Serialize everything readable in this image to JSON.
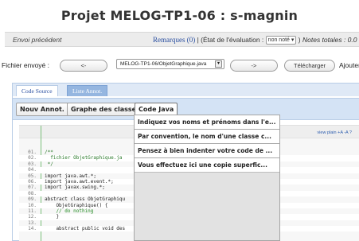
{
  "header": {
    "title": "Projet MELOG-TP1-06 : s-magnin"
  },
  "eval_bar": {
    "prev_label": "Envoi précédent",
    "remarks_link": "Remarques (0)",
    "status_prefix": "| (État de l'évaluation :",
    "status_value": "non noté",
    "status_suffix": ")",
    "totals_label": "Notes totales : 0.0"
  },
  "file_row": {
    "label": "Fichier envoyé :",
    "prev_button": "<-",
    "file_value": "MELOG-TP1-06/ObjetGraphique.java",
    "next_button": "->",
    "download_button": "Télécharger",
    "add_label": "Ajouter"
  },
  "tabs": {
    "source": "Code Source",
    "annotations": "Liste Annot."
  },
  "subbar": {
    "new_annot": "Nouv Annot.",
    "class_graph": "Graphe des classes",
    "java_code": "Code Java"
  },
  "dropdown_items": [
    "Indiquez vos noms et prénoms dans l'e...",
    "Par convention, le nom d'une classe c...",
    "Pensez à bien indenter votre code de ...",
    "Vous effectuez ici une copie superfic..."
  ],
  "code_toolbar": {
    "tools": "view plain  +A  -A  ?"
  },
  "code": {
    "numbers": [
      "01.",
      "02.",
      "03.",
      "04.",
      "05.",
      "06.",
      "07.",
      "08.",
      "09.",
      "10.",
      "11.",
      "12.",
      "13.",
      "14."
    ],
    "lines": [
      "/**",
      "  fichier ObjetGraphique.ja",
      " */",
      "",
      "import java.awt.*;",
      "import java.awt.event.*;",
      "import javax.swing.*;",
      "",
      "abstract class ObjetGraphiqu",
      "    ObjetGraphique() {",
      "    // do nothing",
      "    }",
      "",
      "    abstract public void des"
    ]
  }
}
